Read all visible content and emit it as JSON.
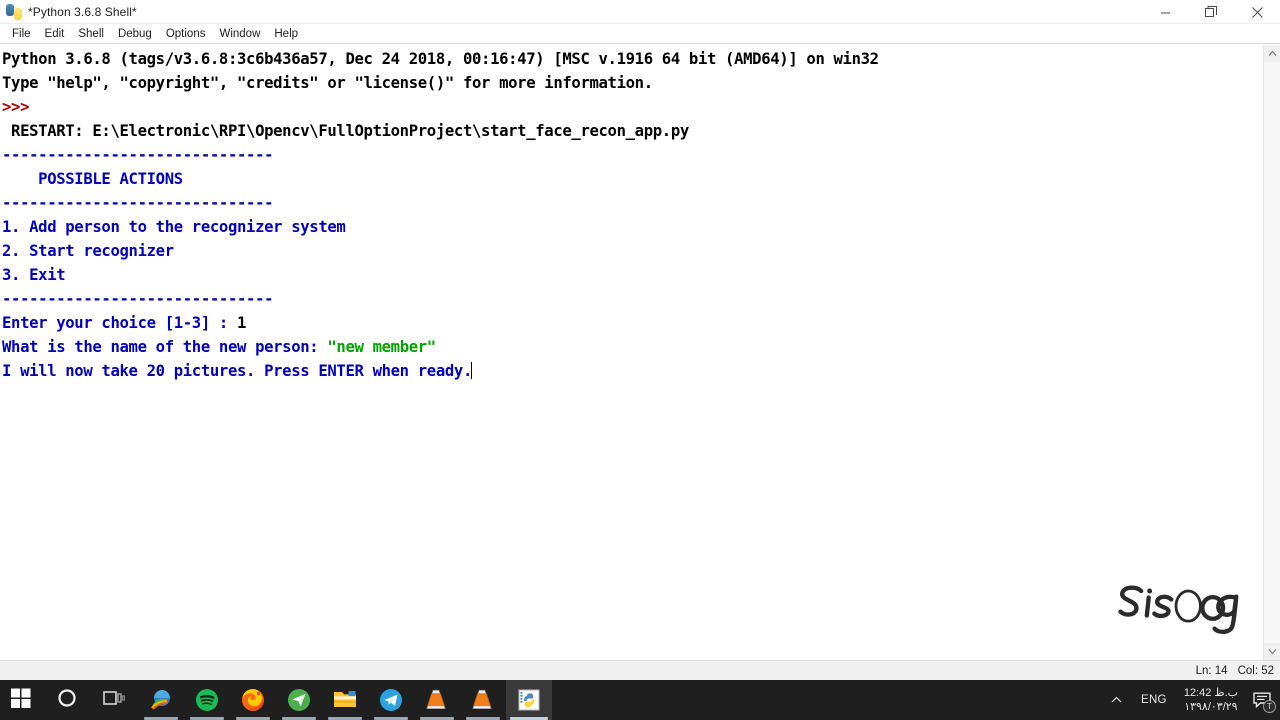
{
  "window": {
    "title": "*Python 3.6.8 Shell*",
    "icon": "python-idle-icon",
    "controls": {
      "minimize": "minimize",
      "maximize": "maximize",
      "close": "close"
    }
  },
  "menubar": {
    "items": [
      "File",
      "Edit",
      "Shell",
      "Debug",
      "Options",
      "Window",
      "Help"
    ]
  },
  "console": {
    "lines": [
      {
        "segments": [
          {
            "text": "Python 3.6.8 (tags/v3.6.8:3c6b436a57, Dec 24 2018, 00:16:47) [MSC v.1916 64 bit (AMD64)] on win32",
            "kind": "std"
          }
        ]
      },
      {
        "segments": [
          {
            "text": "Type \"help\", \"copyright\", \"credits\" or \"license()\" for more information.",
            "kind": "std"
          }
        ]
      },
      {
        "segments": [
          {
            "text": ">>>",
            "kind": "prompt"
          }
        ]
      },
      {
        "segments": [
          {
            "text": " RESTART: E:\\Electronic\\RPI\\Opencv\\FullOptionProject\\start_face_recon_app.py",
            "kind": "std"
          }
        ]
      },
      {
        "segments": [
          {
            "text": "------------------------------",
            "kind": "out"
          }
        ]
      },
      {
        "segments": [
          {
            "text": "    POSSIBLE ACTIONS",
            "kind": "out"
          }
        ]
      },
      {
        "segments": [
          {
            "text": "------------------------------",
            "kind": "out"
          }
        ]
      },
      {
        "segments": [
          {
            "text": "1. Add person to the recognizer system",
            "kind": "out"
          }
        ]
      },
      {
        "segments": [
          {
            "text": "2. Start recognizer",
            "kind": "out"
          }
        ]
      },
      {
        "segments": [
          {
            "text": "3. Exit",
            "kind": "out"
          }
        ]
      },
      {
        "segments": [
          {
            "text": "------------------------------",
            "kind": "out"
          }
        ]
      },
      {
        "segments": [
          {
            "text": "Enter your choice [1-3] : ",
            "kind": "out"
          },
          {
            "text": "1",
            "kind": "std"
          }
        ]
      },
      {
        "segments": [
          {
            "text": "What is the name of the new person: ",
            "kind": "out"
          },
          {
            "text": "\"new member\"",
            "kind": "in"
          }
        ]
      },
      {
        "segments": [
          {
            "text": "I will now take 20 pictures. Press ENTER when ready.",
            "kind": "out"
          },
          {
            "text": "",
            "kind": "caret"
          }
        ]
      }
    ],
    "colors": {
      "stdout": "#0000bb",
      "prompt": "#aa0000",
      "stdin": "#00a000",
      "normal": "#000000"
    }
  },
  "watermark": {
    "text": "Sisoog"
  },
  "scrollbar": {
    "up": "scroll-up",
    "down": "scroll-down"
  },
  "statusbar": {
    "line": "Ln: 14",
    "col": "Col: 52"
  },
  "taskbar": {
    "buttons": [
      {
        "name": "start-button",
        "icon": "windows-logo-icon",
        "state": "idle"
      },
      {
        "name": "cortana-search-button",
        "icon": "circle-icon",
        "state": "idle"
      },
      {
        "name": "task-view-button",
        "icon": "task-view-icon",
        "state": "idle"
      },
      {
        "name": "internet-download-manager-button",
        "icon": "idm-globe-icon",
        "state": "running"
      },
      {
        "name": "spotify-button",
        "icon": "spotify-icon",
        "state": "running"
      },
      {
        "name": "firefox-button",
        "icon": "firefox-icon",
        "state": "running"
      },
      {
        "name": "proxy-client-button",
        "icon": "green-paper-plane-icon",
        "state": "running"
      },
      {
        "name": "file-explorer-button",
        "icon": "folder-icon",
        "state": "running"
      },
      {
        "name": "telegram-button",
        "icon": "telegram-icon",
        "state": "running"
      },
      {
        "name": "vlc-button-1",
        "icon": "vlc-cone-icon",
        "state": "running"
      },
      {
        "name": "vlc-button-2",
        "icon": "vlc-cone-icon",
        "state": "running"
      },
      {
        "name": "python-idle-button",
        "icon": "python-idle-icon",
        "state": "active"
      }
    ],
    "tray": {
      "chevron": "show-hidden-icons",
      "language": "ENG",
      "time": "12:42 ب.ظ",
      "date": "۱۳۹۸/۰۳/۲۹",
      "action_center": "action-center-icon",
      "action_badge": "T"
    }
  }
}
